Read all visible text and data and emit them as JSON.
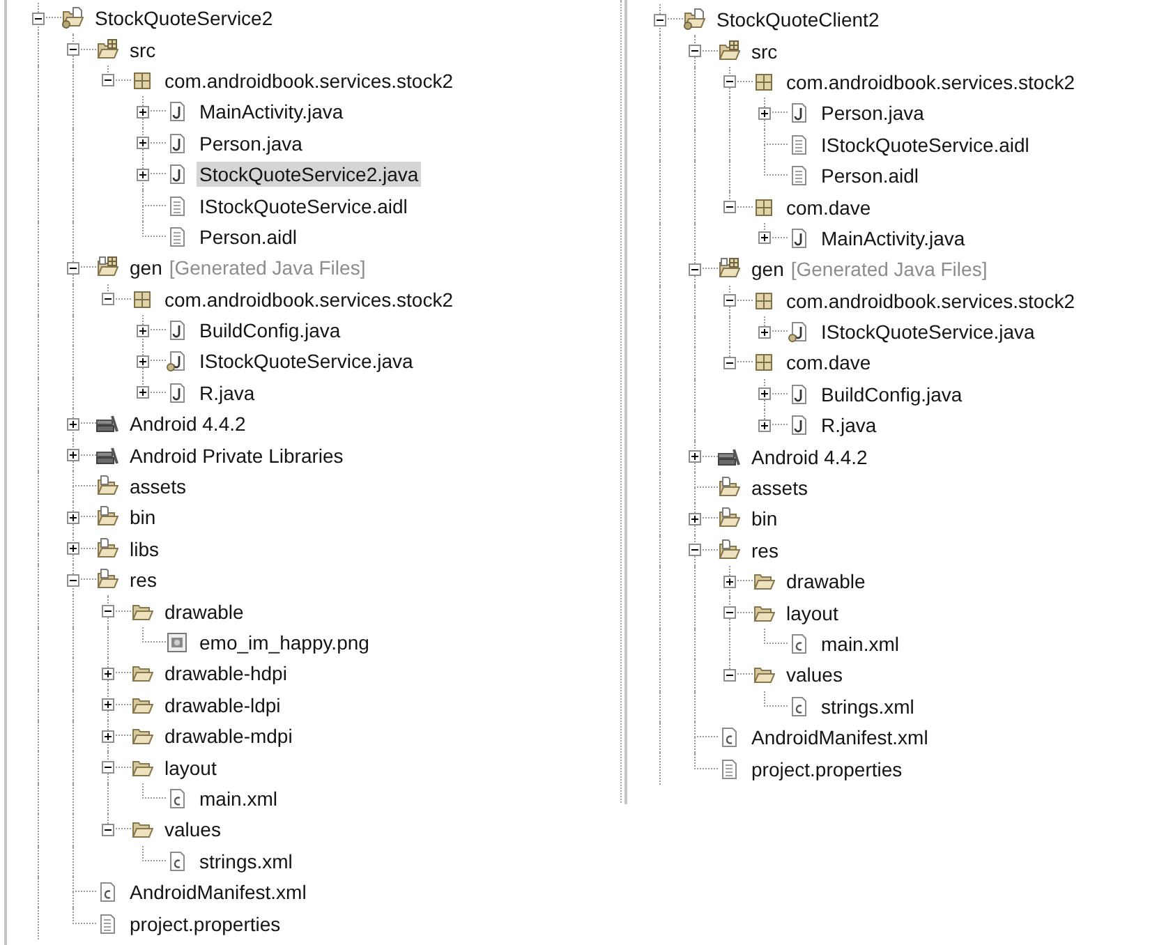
{
  "project_trees": [
    {
      "items": [
        {
          "label": "StockQuoteService2",
          "kind": "project",
          "expanded": true,
          "selected": false,
          "children": [
            {
              "label": "src",
              "kind": "source_folder",
              "expanded": true,
              "selected": false,
              "children": [
                {
                  "label": "com.androidbook.services.stock2",
                  "kind": "package",
                  "expanded": true,
                  "selected": false,
                  "children": [
                    {
                      "label": "MainActivity.java",
                      "kind": "java",
                      "expanded": false,
                      "selected": false
                    },
                    {
                      "label": "Person.java",
                      "kind": "java",
                      "expanded": false,
                      "selected": false
                    },
                    {
                      "label": "StockQuoteService2.java",
                      "kind": "java",
                      "expanded": false,
                      "selected": true
                    },
                    {
                      "label": "IStockQuoteService.aidl",
                      "kind": "text",
                      "selected": false
                    },
                    {
                      "label": "Person.aidl",
                      "kind": "text",
                      "selected": false
                    }
                  ]
                }
              ]
            },
            {
              "label": "gen",
              "decoration": "[Generated Java Files]",
              "kind": "generated_folder",
              "expanded": true,
              "selected": false,
              "children": [
                {
                  "label": "com.androidbook.services.stock2",
                  "kind": "package",
                  "expanded": true,
                  "selected": false,
                  "children": [
                    {
                      "label": "BuildConfig.java",
                      "kind": "java",
                      "expanded": false,
                      "selected": false
                    },
                    {
                      "label": "IStockQuoteService.java",
                      "kind": "generated_java",
                      "expanded": false,
                      "selected": false
                    },
                    {
                      "label": "R.java",
                      "kind": "java",
                      "expanded": false,
                      "selected": false
                    }
                  ]
                }
              ]
            },
            {
              "label": "Android 4.4.2",
              "kind": "library",
              "expanded": false,
              "selected": false
            },
            {
              "label": "Android Private Libraries",
              "kind": "library",
              "expanded": false,
              "selected": false
            },
            {
              "label": "assets",
              "kind": "resource_folder",
              "selected": false
            },
            {
              "label": "bin",
              "kind": "resource_folder",
              "expanded": false,
              "selected": false
            },
            {
              "label": "libs",
              "kind": "resource_folder",
              "expanded": false,
              "selected": false
            },
            {
              "label": "res",
              "kind": "resource_folder",
              "expanded": true,
              "selected": false,
              "children": [
                {
                  "label": "drawable",
                  "kind": "folder",
                  "expanded": true,
                  "selected": false,
                  "children": [
                    {
                      "label": "emo_im_happy.png",
                      "kind": "image",
                      "selected": false
                    }
                  ]
                },
                {
                  "label": "drawable-hdpi",
                  "kind": "folder",
                  "expanded": false,
                  "selected": false
                },
                {
                  "label": "drawable-ldpi",
                  "kind": "folder",
                  "expanded": false,
                  "selected": false
                },
                {
                  "label": "drawable-mdpi",
                  "kind": "folder",
                  "expanded": false,
                  "selected": false
                },
                {
                  "label": "layout",
                  "kind": "folder",
                  "expanded": true,
                  "selected": false,
                  "children": [
                    {
                      "label": "main.xml",
                      "kind": "xml",
                      "selected": false
                    }
                  ]
                },
                {
                  "label": "values",
                  "kind": "folder",
                  "expanded": true,
                  "selected": false,
                  "children": [
                    {
                      "label": "strings.xml",
                      "kind": "xml",
                      "selected": false
                    }
                  ]
                }
              ]
            },
            {
              "label": "AndroidManifest.xml",
              "kind": "xml",
              "selected": false
            },
            {
              "label": "project.properties",
              "kind": "text",
              "selected": false
            }
          ]
        }
      ]
    },
    {
      "items": [
        {
          "label": "StockQuoteClient2",
          "kind": "project",
          "expanded": true,
          "selected": false,
          "children": [
            {
              "label": "src",
              "kind": "source_folder",
              "expanded": true,
              "selected": false,
              "children": [
                {
                  "label": "com.androidbook.services.stock2",
                  "kind": "package",
                  "expanded": true,
                  "selected": false,
                  "children": [
                    {
                      "label": "Person.java",
                      "kind": "java",
                      "expanded": false,
                      "selected": false
                    },
                    {
                      "label": "IStockQuoteService.aidl",
                      "kind": "text",
                      "selected": false
                    },
                    {
                      "label": "Person.aidl",
                      "kind": "text",
                      "selected": false
                    }
                  ]
                },
                {
                  "label": "com.dave",
                  "kind": "package",
                  "expanded": true,
                  "selected": false,
                  "children": [
                    {
                      "label": "MainActivity.java",
                      "kind": "java",
                      "expanded": false,
                      "selected": false
                    }
                  ]
                }
              ]
            },
            {
              "label": "gen",
              "decoration": "[Generated Java Files]",
              "kind": "generated_folder",
              "expanded": true,
              "selected": false,
              "children": [
                {
                  "label": "com.androidbook.services.stock2",
                  "kind": "package",
                  "expanded": true,
                  "selected": false,
                  "children": [
                    {
                      "label": "IStockQuoteService.java",
                      "kind": "generated_java",
                      "expanded": false,
                      "selected": false
                    }
                  ]
                },
                {
                  "label": "com.dave",
                  "kind": "package",
                  "expanded": true,
                  "selected": false,
                  "children": [
                    {
                      "label": "BuildConfig.java",
                      "kind": "java",
                      "expanded": false,
                      "selected": false
                    },
                    {
                      "label": "R.java",
                      "kind": "java",
                      "expanded": false,
                      "selected": false
                    }
                  ]
                }
              ]
            },
            {
              "label": "Android 4.4.2",
              "kind": "library",
              "expanded": false,
              "selected": false
            },
            {
              "label": "assets",
              "kind": "resource_folder",
              "selected": false
            },
            {
              "label": "bin",
              "kind": "resource_folder",
              "expanded": false,
              "selected": false
            },
            {
              "label": "res",
              "kind": "resource_folder",
              "expanded": true,
              "selected": false,
              "children": [
                {
                  "label": "drawable",
                  "kind": "folder",
                  "expanded": false,
                  "selected": false
                },
                {
                  "label": "layout",
                  "kind": "folder",
                  "expanded": true,
                  "selected": false,
                  "children": [
                    {
                      "label": "main.xml",
                      "kind": "xml",
                      "selected": false
                    }
                  ]
                },
                {
                  "label": "values",
                  "kind": "folder",
                  "expanded": true,
                  "selected": false,
                  "children": [
                    {
                      "label": "strings.xml",
                      "kind": "xml",
                      "selected": false
                    }
                  ]
                }
              ]
            },
            {
              "label": "AndroidManifest.xml",
              "kind": "xml",
              "selected": false
            },
            {
              "label": "project.properties",
              "kind": "text",
              "selected": false
            }
          ]
        }
      ]
    }
  ]
}
